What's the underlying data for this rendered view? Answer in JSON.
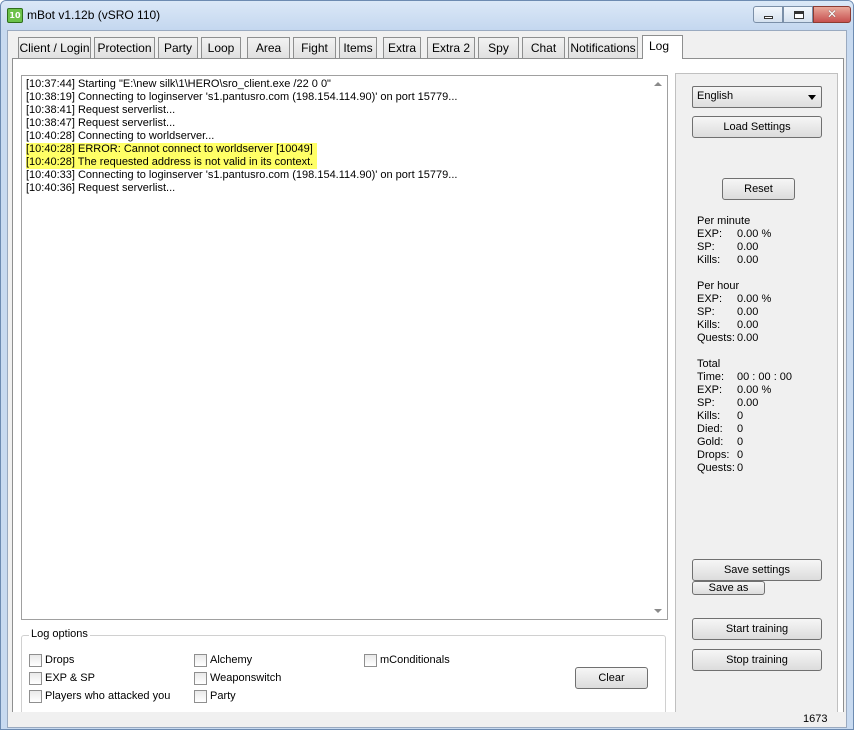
{
  "window": {
    "title": "mBot v1.12b (vSRO 110)",
    "icon_text": "10"
  },
  "tabs": [
    {
      "label": "Client / Login"
    },
    {
      "label": "Protection"
    },
    {
      "label": "Party"
    },
    {
      "label": "Loop"
    },
    {
      "label": "Area"
    },
    {
      "label": "Fight"
    },
    {
      "label": "Items"
    },
    {
      "label": "Extra"
    },
    {
      "label": "Extra 2"
    },
    {
      "label": "Spy"
    },
    {
      "label": "Chat"
    },
    {
      "label": "Notifications"
    },
    {
      "label": "Log"
    }
  ],
  "active_tab": "Log",
  "log": {
    "lines": [
      {
        "text": "[10:37:44] Starting \"E:\\new silk\\1\\HERO\\sro_client.exe /22 0 0\"",
        "highlight": false
      },
      {
        "text": "[10:38:19] Connecting to loginserver 's1.pantusro.com (198.154.114.90)' on port 15779...",
        "highlight": false
      },
      {
        "text": "[10:38:41] Request serverlist...",
        "highlight": false
      },
      {
        "text": "[10:38:47] Request serverlist...",
        "highlight": false
      },
      {
        "text": "[10:40:28] Connecting to worldserver...",
        "highlight": false
      },
      {
        "text": "[10:40:28] ERROR: Cannot connect to worldserver [10049]",
        "highlight": true
      },
      {
        "text": "[10:40:28] The requested address is not valid in its context.",
        "highlight": true
      },
      {
        "text": "[10:40:33] Connecting to loginserver 's1.pantusro.com (198.154.114.90)' on port 15779...",
        "highlight": false
      },
      {
        "text": "[10:40:36] Request serverlist...",
        "highlight": false
      }
    ],
    "highlight_color": "#ffff66"
  },
  "log_options": {
    "title": "Log options",
    "checkboxes": [
      {
        "label": "Drops"
      },
      {
        "label": "EXP & SP"
      },
      {
        "label": "Players who attacked you"
      },
      {
        "label": "Alchemy"
      },
      {
        "label": "Weaponswitch"
      },
      {
        "label": "Party"
      },
      {
        "label": "mConditionals"
      }
    ],
    "clear_label": "Clear"
  },
  "sidebar": {
    "language": "English",
    "load_settings": "Load Settings",
    "reset": "Reset",
    "per_minute": {
      "title": "Per minute",
      "exp_label": "EXP:",
      "exp_value": "0.00 %",
      "sp_label": "SP:",
      "sp_value": "0.00",
      "kills_label": "Kills:",
      "kills_value": "0.00"
    },
    "per_hour": {
      "title": "Per hour",
      "exp_label": "EXP:",
      "exp_value": "0.00 %",
      "sp_label": "SP:",
      "sp_value": "0.00",
      "kills_label": "Kills:",
      "kills_value": "0.00",
      "quests_label": "Quests:",
      "quests_value": "0.00"
    },
    "total": {
      "title": "Total",
      "time_label": "Time:",
      "time_value": "00 : 00 : 00",
      "exp_label": "EXP:",
      "exp_value": "0.00 %",
      "sp_label": "SP:",
      "sp_value": "0.00",
      "kills_label": "Kills:",
      "kills_value": "0",
      "died_label": "Died:",
      "died_value": "0",
      "gold_label": "Gold:",
      "gold_value": "0",
      "drops_label": "Drops:",
      "drops_value": "0",
      "quests_label": "Quests:",
      "quests_value": "0"
    },
    "save_settings": "Save settings",
    "save_as": "Save as",
    "start_training": "Start training",
    "stop_training": "Stop training"
  },
  "status_bar": {
    "value": "1673"
  }
}
